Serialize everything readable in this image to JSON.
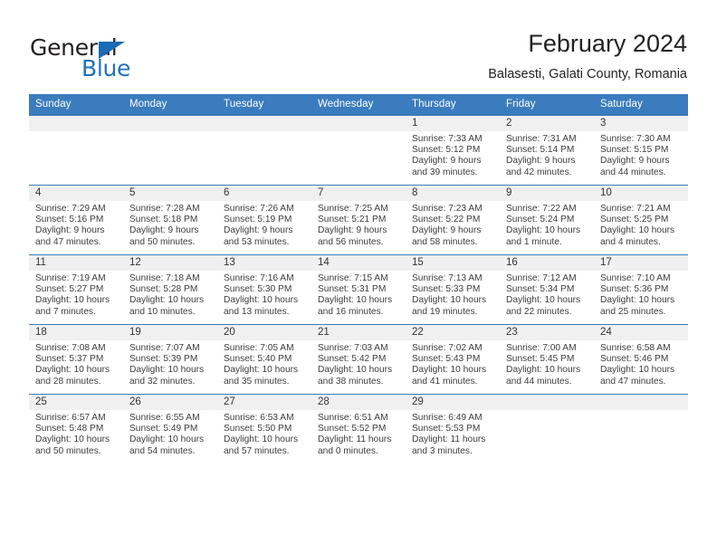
{
  "brand": {
    "name_part1": "General",
    "name_part2": "Blue",
    "logo_color": "#1a6cb5"
  },
  "header": {
    "title": "February 2024",
    "location": "Balasesti, Galati County, Romania",
    "accent_color": "#3a7cbe"
  },
  "calendar": {
    "weekday_headers": [
      "Sunday",
      "Monday",
      "Tuesday",
      "Wednesday",
      "Thursday",
      "Friday",
      "Saturday"
    ],
    "weeks": [
      [
        {
          "day": "",
          "sunrise": "",
          "sunset": "",
          "daylight_line1": "",
          "daylight_line2": ""
        },
        {
          "day": "",
          "sunrise": "",
          "sunset": "",
          "daylight_line1": "",
          "daylight_line2": ""
        },
        {
          "day": "",
          "sunrise": "",
          "sunset": "",
          "daylight_line1": "",
          "daylight_line2": ""
        },
        {
          "day": "",
          "sunrise": "",
          "sunset": "",
          "daylight_line1": "",
          "daylight_line2": ""
        },
        {
          "day": "1",
          "sunrise": "Sunrise: 7:33 AM",
          "sunset": "Sunset: 5:12 PM",
          "daylight_line1": "Daylight: 9 hours",
          "daylight_line2": "and 39 minutes."
        },
        {
          "day": "2",
          "sunrise": "Sunrise: 7:31 AM",
          "sunset": "Sunset: 5:14 PM",
          "daylight_line1": "Daylight: 9 hours",
          "daylight_line2": "and 42 minutes."
        },
        {
          "day": "3",
          "sunrise": "Sunrise: 7:30 AM",
          "sunset": "Sunset: 5:15 PM",
          "daylight_line1": "Daylight: 9 hours",
          "daylight_line2": "and 44 minutes."
        }
      ],
      [
        {
          "day": "4",
          "sunrise": "Sunrise: 7:29 AM",
          "sunset": "Sunset: 5:16 PM",
          "daylight_line1": "Daylight: 9 hours",
          "daylight_line2": "and 47 minutes."
        },
        {
          "day": "5",
          "sunrise": "Sunrise: 7:28 AM",
          "sunset": "Sunset: 5:18 PM",
          "daylight_line1": "Daylight: 9 hours",
          "daylight_line2": "and 50 minutes."
        },
        {
          "day": "6",
          "sunrise": "Sunrise: 7:26 AM",
          "sunset": "Sunset: 5:19 PM",
          "daylight_line1": "Daylight: 9 hours",
          "daylight_line2": "and 53 minutes."
        },
        {
          "day": "7",
          "sunrise": "Sunrise: 7:25 AM",
          "sunset": "Sunset: 5:21 PM",
          "daylight_line1": "Daylight: 9 hours",
          "daylight_line2": "and 56 minutes."
        },
        {
          "day": "8",
          "sunrise": "Sunrise: 7:23 AM",
          "sunset": "Sunset: 5:22 PM",
          "daylight_line1": "Daylight: 9 hours",
          "daylight_line2": "and 58 minutes."
        },
        {
          "day": "9",
          "sunrise": "Sunrise: 7:22 AM",
          "sunset": "Sunset: 5:24 PM",
          "daylight_line1": "Daylight: 10 hours",
          "daylight_line2": "and 1 minute."
        },
        {
          "day": "10",
          "sunrise": "Sunrise: 7:21 AM",
          "sunset": "Sunset: 5:25 PM",
          "daylight_line1": "Daylight: 10 hours",
          "daylight_line2": "and 4 minutes."
        }
      ],
      [
        {
          "day": "11",
          "sunrise": "Sunrise: 7:19 AM",
          "sunset": "Sunset: 5:27 PM",
          "daylight_line1": "Daylight: 10 hours",
          "daylight_line2": "and 7 minutes."
        },
        {
          "day": "12",
          "sunrise": "Sunrise: 7:18 AM",
          "sunset": "Sunset: 5:28 PM",
          "daylight_line1": "Daylight: 10 hours",
          "daylight_line2": "and 10 minutes."
        },
        {
          "day": "13",
          "sunrise": "Sunrise: 7:16 AM",
          "sunset": "Sunset: 5:30 PM",
          "daylight_line1": "Daylight: 10 hours",
          "daylight_line2": "and 13 minutes."
        },
        {
          "day": "14",
          "sunrise": "Sunrise: 7:15 AM",
          "sunset": "Sunset: 5:31 PM",
          "daylight_line1": "Daylight: 10 hours",
          "daylight_line2": "and 16 minutes."
        },
        {
          "day": "15",
          "sunrise": "Sunrise: 7:13 AM",
          "sunset": "Sunset: 5:33 PM",
          "daylight_line1": "Daylight: 10 hours",
          "daylight_line2": "and 19 minutes."
        },
        {
          "day": "16",
          "sunrise": "Sunrise: 7:12 AM",
          "sunset": "Sunset: 5:34 PM",
          "daylight_line1": "Daylight: 10 hours",
          "daylight_line2": "and 22 minutes."
        },
        {
          "day": "17",
          "sunrise": "Sunrise: 7:10 AM",
          "sunset": "Sunset: 5:36 PM",
          "daylight_line1": "Daylight: 10 hours",
          "daylight_line2": "and 25 minutes."
        }
      ],
      [
        {
          "day": "18",
          "sunrise": "Sunrise: 7:08 AM",
          "sunset": "Sunset: 5:37 PM",
          "daylight_line1": "Daylight: 10 hours",
          "daylight_line2": "and 28 minutes."
        },
        {
          "day": "19",
          "sunrise": "Sunrise: 7:07 AM",
          "sunset": "Sunset: 5:39 PM",
          "daylight_line1": "Daylight: 10 hours",
          "daylight_line2": "and 32 minutes."
        },
        {
          "day": "20",
          "sunrise": "Sunrise: 7:05 AM",
          "sunset": "Sunset: 5:40 PM",
          "daylight_line1": "Daylight: 10 hours",
          "daylight_line2": "and 35 minutes."
        },
        {
          "day": "21",
          "sunrise": "Sunrise: 7:03 AM",
          "sunset": "Sunset: 5:42 PM",
          "daylight_line1": "Daylight: 10 hours",
          "daylight_line2": "and 38 minutes."
        },
        {
          "day": "22",
          "sunrise": "Sunrise: 7:02 AM",
          "sunset": "Sunset: 5:43 PM",
          "daylight_line1": "Daylight: 10 hours",
          "daylight_line2": "and 41 minutes."
        },
        {
          "day": "23",
          "sunrise": "Sunrise: 7:00 AM",
          "sunset": "Sunset: 5:45 PM",
          "daylight_line1": "Daylight: 10 hours",
          "daylight_line2": "and 44 minutes."
        },
        {
          "day": "24",
          "sunrise": "Sunrise: 6:58 AM",
          "sunset": "Sunset: 5:46 PM",
          "daylight_line1": "Daylight: 10 hours",
          "daylight_line2": "and 47 minutes."
        }
      ],
      [
        {
          "day": "25",
          "sunrise": "Sunrise: 6:57 AM",
          "sunset": "Sunset: 5:48 PM",
          "daylight_line1": "Daylight: 10 hours",
          "daylight_line2": "and 50 minutes."
        },
        {
          "day": "26",
          "sunrise": "Sunrise: 6:55 AM",
          "sunset": "Sunset: 5:49 PM",
          "daylight_line1": "Daylight: 10 hours",
          "daylight_line2": "and 54 minutes."
        },
        {
          "day": "27",
          "sunrise": "Sunrise: 6:53 AM",
          "sunset": "Sunset: 5:50 PM",
          "daylight_line1": "Daylight: 10 hours",
          "daylight_line2": "and 57 minutes."
        },
        {
          "day": "28",
          "sunrise": "Sunrise: 6:51 AM",
          "sunset": "Sunset: 5:52 PM",
          "daylight_line1": "Daylight: 11 hours",
          "daylight_line2": "and 0 minutes."
        },
        {
          "day": "29",
          "sunrise": "Sunrise: 6:49 AM",
          "sunset": "Sunset: 5:53 PM",
          "daylight_line1": "Daylight: 11 hours",
          "daylight_line2": "and 3 minutes."
        },
        {
          "day": "",
          "sunrise": "",
          "sunset": "",
          "daylight_line1": "",
          "daylight_line2": ""
        },
        {
          "day": "",
          "sunrise": "",
          "sunset": "",
          "daylight_line1": "",
          "daylight_line2": ""
        }
      ]
    ]
  }
}
